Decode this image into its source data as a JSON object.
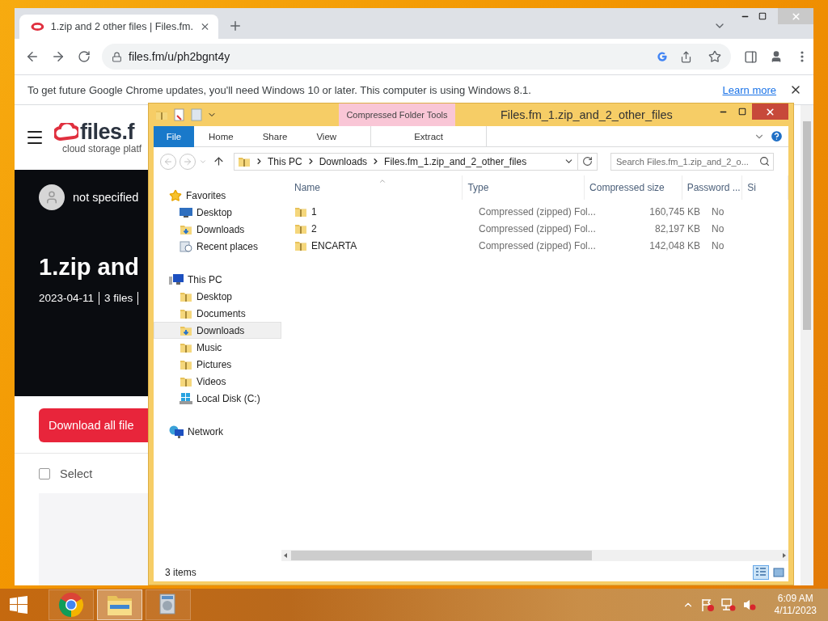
{
  "chrome": {
    "tab": {
      "title": "1.zip and 2 other files | Files.fm."
    },
    "url": "files.fm/u/ph2bgnt4y",
    "infobar": {
      "message": "To get future Google Chrome updates, you'll need Windows 10 or later. This computer is using Windows 8.1.",
      "link": "Learn more"
    },
    "page": {
      "logo": "files.f",
      "tagline": "cloud storage platf",
      "owner": "not specified",
      "title": "1.zip and",
      "date": "2023-04-11",
      "file_count": "3 files",
      "download_button": "Download all file",
      "select": {
        "label": "Select",
        "checked": false
      }
    }
  },
  "explorer": {
    "context_tab": "Compressed Folder Tools",
    "title": "Files.fm_1.zip_and_2_other_files",
    "ribbon_tabs": [
      {
        "label": "File",
        "kind": "file",
        "selected": false
      },
      {
        "label": "Home",
        "kind": "tab",
        "selected": false
      },
      {
        "label": "Share",
        "kind": "tab",
        "selected": false
      },
      {
        "label": "View",
        "kind": "tab",
        "selected": false
      },
      {
        "label": "Extract",
        "kind": "context",
        "selected": false
      }
    ],
    "breadcrumbs": [
      "This PC",
      "Downloads",
      "Files.fm_1.zip_and_2_other_files"
    ],
    "search": {
      "placeholder": "Search Files.fm_1.zip_and_2_o..."
    },
    "nav": [
      {
        "label": "Favorites",
        "kind": "star",
        "selected": false,
        "children": [
          {
            "label": "Desktop",
            "kind": "monitor",
            "selected": false
          },
          {
            "label": "Downloads",
            "kind": "download",
            "selected": false
          },
          {
            "label": "Recent places",
            "kind": "recent",
            "selected": false
          }
        ]
      },
      {
        "label": "This PC",
        "kind": "computer",
        "selected": false,
        "children": [
          {
            "label": "Desktop",
            "kind": "folder",
            "selected": false
          },
          {
            "label": "Documents",
            "kind": "folder",
            "selected": false
          },
          {
            "label": "Downloads",
            "kind": "download",
            "selected": true
          },
          {
            "label": "Music",
            "kind": "folder",
            "selected": false
          },
          {
            "label": "Pictures",
            "kind": "folder",
            "selected": false
          },
          {
            "label": "Videos",
            "kind": "folder",
            "selected": false
          },
          {
            "label": "Local Disk (C:)",
            "kind": "drive",
            "selected": false
          }
        ]
      },
      {
        "label": "Network",
        "kind": "network",
        "selected": false
      }
    ],
    "columns": [
      "Name",
      "Type",
      "Compressed size",
      "Password ...",
      "Si"
    ],
    "rows": [
      {
        "name": "1",
        "type": "Compressed (zipped) Fol...",
        "size": "160,745 KB",
        "password": "No"
      },
      {
        "name": "2",
        "type": "Compressed (zipped) Fol...",
        "size": "82,197 KB",
        "password": "No"
      },
      {
        "name": "ENCARTA",
        "type": "Compressed (zipped) Fol...",
        "size": "142,048 KB",
        "password": "No"
      }
    ],
    "status": "3 items"
  },
  "taskbar": {
    "apps": [
      {
        "kind": "chrome",
        "selected": false
      },
      {
        "kind": "explorer",
        "selected": true
      },
      {
        "kind": "app",
        "selected": false
      }
    ],
    "time": "6:09 AM",
    "date": "4/11/2023"
  }
}
